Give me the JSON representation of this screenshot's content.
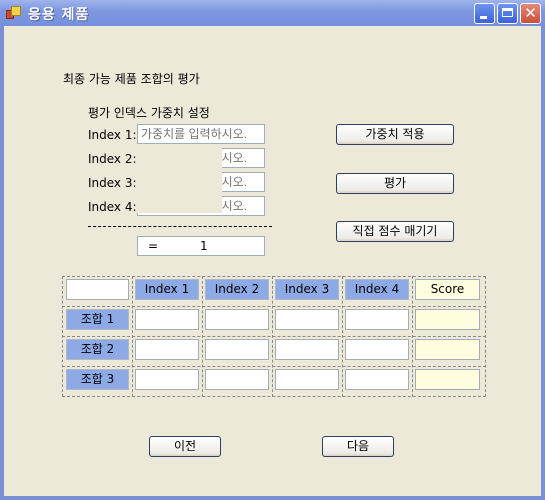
{
  "window": {
    "title": "응용 제품",
    "icon": "application-icon",
    "controls": {
      "minimize": "minimize-icon",
      "maximize": "maximize-icon",
      "close_glyph": "✕"
    }
  },
  "heading": "최종 가능 제품 조합의 평가",
  "weights": {
    "section_label": "평가 인덱스 가중치 설정",
    "rows": [
      {
        "label": "Index 1:",
        "value": "",
        "placeholder": "가중치를 입력하시오."
      },
      {
        "label": "Index 2:",
        "value": "",
        "placeholder": "가중치를 입력하시오."
      },
      {
        "label": "Index 3:",
        "value": "",
        "placeholder": "가중치를 입력하시오."
      },
      {
        "label": "Index 4:",
        "value": "",
        "placeholder": "가중치를 입력하시오."
      }
    ],
    "sum_prefix": "=",
    "sum_value": "1"
  },
  "buttons": {
    "apply_weights": "가중치 적용",
    "evaluate": "평가",
    "manual_score": "직접 점수 매기기",
    "previous": "이전",
    "next": "다음"
  },
  "table": {
    "columns": [
      "Index 1",
      "Index 2",
      "Index 3",
      "Index 4",
      "Score"
    ],
    "rows": [
      {
        "label": "조합 1",
        "values": [
          "",
          "",
          "",
          "",
          ""
        ]
      },
      {
        "label": "조합 2",
        "values": [
          "",
          "",
          "",
          "",
          ""
        ]
      },
      {
        "label": "조합 3",
        "values": [
          "",
          "",
          "",
          "",
          ""
        ]
      }
    ]
  },
  "colors": {
    "header_cell": "#8eaae6",
    "score_cell": "#ffffe0",
    "form_bg": "#ece9d8",
    "titlebar": "#7f98e0"
  }
}
